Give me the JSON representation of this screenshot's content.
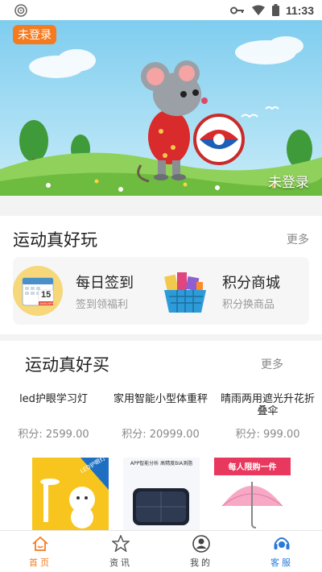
{
  "status_bar": {
    "time": "11:33"
  },
  "banner": {
    "badge": "未登录",
    "caption": "未登录"
  },
  "section_play": {
    "title": "运动真好玩",
    "more": "更多",
    "cards": [
      {
        "title": "每日签到",
        "subtitle": "签到领福利",
        "icon": "calendar-icon",
        "calendar_day": "15",
        "calendar_month": "JANUARY"
      },
      {
        "title": "积分商城",
        "subtitle": "积分换商品",
        "icon": "shopping-basket-icon"
      }
    ]
  },
  "section_buy": {
    "title": "运动真好买",
    "more": "更多",
    "products": [
      {
        "name": "led护眼学习灯",
        "price": "积分: 2599.00",
        "image_text": "LED护眼灯"
      },
      {
        "name": "家用智能小型体重秤",
        "price": "积分: 20999.00",
        "image_text": "APP智能分析 高精度BIA测脂"
      },
      {
        "name": "晴雨两用遮光升花折叠伞",
        "price": "积分: 999.00",
        "image_text": "每人限购一件"
      }
    ]
  },
  "bottom_nav": [
    {
      "label": "首页",
      "icon": "home-icon"
    },
    {
      "label": "资讯",
      "icon": "star-icon"
    },
    {
      "label": "我的",
      "icon": "user-icon"
    },
    {
      "label": "客服",
      "icon": "headset-icon"
    }
  ],
  "colors": {
    "accent": "#f47b20",
    "service": "#2979d8",
    "sky": "#8ed3f2",
    "grass": "#7cc24a"
  }
}
